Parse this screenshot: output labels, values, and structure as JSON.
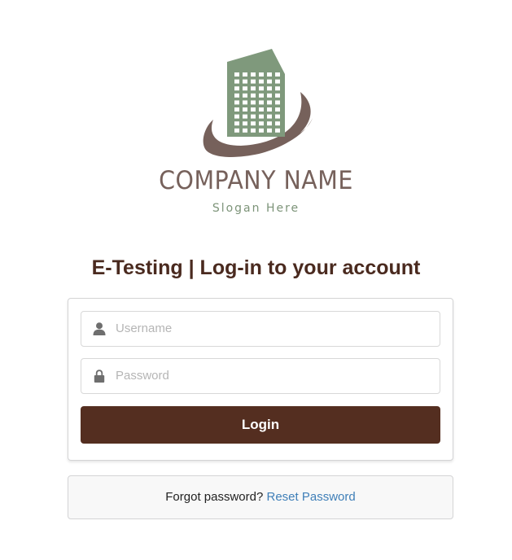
{
  "logo": {
    "company_name": "COMPANY NAME",
    "slogan": "Slogan Here",
    "colors": {
      "building": "#7f997c",
      "swoosh": "#76615b",
      "windows": "#ffffff"
    }
  },
  "heading": "E-Testing | Log-in to your account",
  "form": {
    "username": {
      "placeholder": "Username",
      "value": "",
      "icon": "user-icon"
    },
    "password": {
      "placeholder": "Password",
      "value": "",
      "icon": "lock-icon"
    },
    "login_label": "Login"
  },
  "reset": {
    "prompt": "Forgot password?",
    "link_label": "Reset Password"
  },
  "colors": {
    "heading": "#4a2a1f",
    "button": "#542e20",
    "link": "#3f7fb8"
  }
}
